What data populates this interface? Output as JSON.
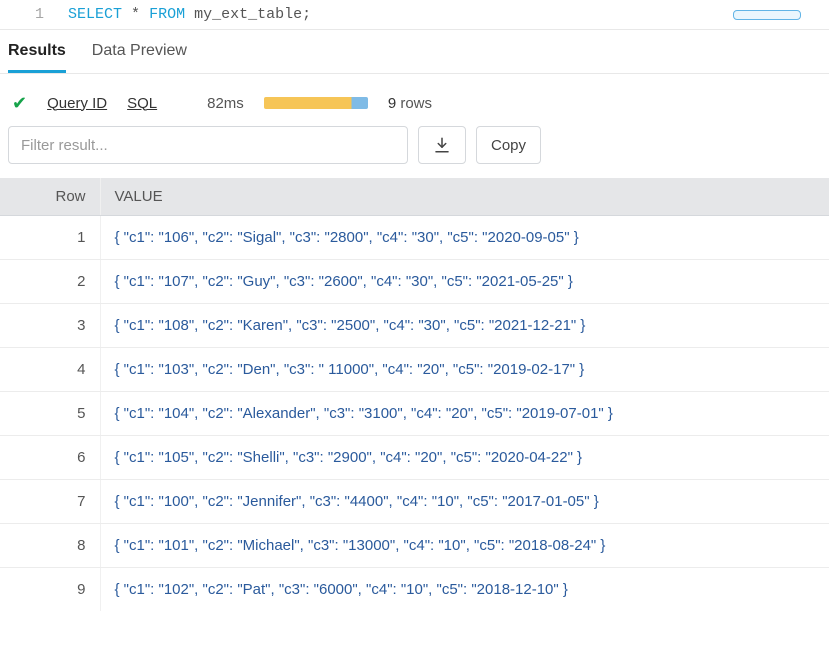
{
  "editor": {
    "line_number": "1",
    "kw_select": "SELECT",
    "star": "*",
    "kw_from": "FROM",
    "rest": " my_ext_table;"
  },
  "tabs": {
    "results": "Results",
    "preview": "Data Preview"
  },
  "status": {
    "query_id": "Query ID",
    "sql": "SQL",
    "timing": "82ms",
    "row_count": "9",
    "rows_word": "rows"
  },
  "controls": {
    "filter_placeholder": "Filter result...",
    "copy": "Copy"
  },
  "table": {
    "headers": {
      "row": "Row",
      "value": "VALUE"
    },
    "rows": [
      {
        "n": "1",
        "value": "{ \"c1\": \"106\", \"c2\": \"Sigal\", \"c3\": \"2800\", \"c4\": \"30\", \"c5\": \"2020-09-05\" }"
      },
      {
        "n": "2",
        "value": "{ \"c1\": \"107\", \"c2\": \"Guy\", \"c3\": \"2600\", \"c4\": \"30\", \"c5\": \"2021-05-25\" }"
      },
      {
        "n": "3",
        "value": "{ \"c1\": \"108\", \"c2\": \"Karen\", \"c3\": \"2500\", \"c4\": \"30\", \"c5\": \"2021-12-21\" }"
      },
      {
        "n": "4",
        "value": "{ \"c1\": \"103\", \"c2\": \"Den\", \"c3\": \" 11000\", \"c4\": \"20\", \"c5\": \"2019-02-17\" }"
      },
      {
        "n": "5",
        "value": "{ \"c1\": \"104\", \"c2\": \"Alexander\", \"c3\": \"3100\", \"c4\": \"20\", \"c5\": \"2019-07-01\" }"
      },
      {
        "n": "6",
        "value": "{ \"c1\": \"105\", \"c2\": \"Shelli\", \"c3\": \"2900\", \"c4\": \"20\", \"c5\": \"2020-04-22\" }"
      },
      {
        "n": "7",
        "value": "{ \"c1\": \"100\", \"c2\": \"Jennifer\", \"c3\": \"4400\", \"c4\": \"10\", \"c5\": \"2017-01-05\" }"
      },
      {
        "n": "8",
        "value": "{ \"c1\": \"101\", \"c2\": \"Michael\", \"c3\": \"13000\", \"c4\": \"10\", \"c5\": \"2018-08-24\" }"
      },
      {
        "n": "9",
        "value": "{ \"c1\": \"102\", \"c2\": \"Pat\", \"c3\": \"6000\", \"c4\": \"10\", \"c5\": \"2018-12-10\" }"
      }
    ]
  }
}
